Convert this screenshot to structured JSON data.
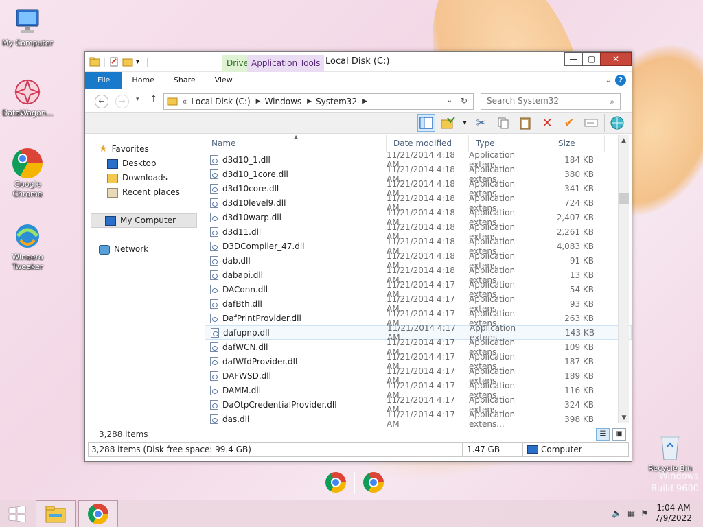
{
  "desktop": {
    "icons": [
      {
        "label": "My Computer"
      },
      {
        "label": "DataWagon..."
      },
      {
        "label": "Google Chrome"
      },
      {
        "label": "Winaero Tweaker"
      },
      {
        "label": "Recycle Bin"
      }
    ],
    "watermark_line1": "Windows",
    "watermark_line2": "Build 9600"
  },
  "window": {
    "title": "Local Disk (C:)",
    "context_tab_drive": "Drive",
    "context_tab_app": "Application Tools",
    "controls": {
      "minimize": "—",
      "maximize": "▢",
      "close": "✕"
    },
    "ribbon_tabs": [
      "File",
      "Home",
      "Share",
      "View"
    ],
    "address": {
      "prefix": "«",
      "segments": [
        "Local Disk (C:)",
        "Windows",
        "System32"
      ]
    },
    "search": {
      "placeholder": "Search System32"
    },
    "nav": {
      "favorites": "Favorites",
      "desktop": "Desktop",
      "downloads": "Downloads",
      "recent": "Recent places",
      "my_computer": "My Computer",
      "network": "Network"
    },
    "columns": {
      "name": "Name",
      "date": "Date modified",
      "type": "Type",
      "size": "Size"
    },
    "files": [
      {
        "name": "d3d10_1.dll",
        "date": "11/21/2014 4:18 AM",
        "type": "Application extens...",
        "size": "184 KB"
      },
      {
        "name": "d3d10_1core.dll",
        "date": "11/21/2014 4:18 AM",
        "type": "Application extens...",
        "size": "380 KB"
      },
      {
        "name": "d3d10core.dll",
        "date": "11/21/2014 4:18 AM",
        "type": "Application extens...",
        "size": "341 KB"
      },
      {
        "name": "d3d10level9.dll",
        "date": "11/21/2014 4:18 AM",
        "type": "Application extens...",
        "size": "724 KB"
      },
      {
        "name": "d3d10warp.dll",
        "date": "11/21/2014 4:18 AM",
        "type": "Application extens...",
        "size": "2,407 KB"
      },
      {
        "name": "d3d11.dll",
        "date": "11/21/2014 4:18 AM",
        "type": "Application extens...",
        "size": "2,261 KB"
      },
      {
        "name": "D3DCompiler_47.dll",
        "date": "11/21/2014 4:18 AM",
        "type": "Application extens...",
        "size": "4,083 KB"
      },
      {
        "name": "dab.dll",
        "date": "11/21/2014 4:18 AM",
        "type": "Application extens...",
        "size": "91 KB"
      },
      {
        "name": "dabapi.dll",
        "date": "11/21/2014 4:18 AM",
        "type": "Application extens...",
        "size": "13 KB"
      },
      {
        "name": "DAConn.dll",
        "date": "11/21/2014 4:17 AM",
        "type": "Application extens...",
        "size": "54 KB"
      },
      {
        "name": "dafBth.dll",
        "date": "11/21/2014 4:17 AM",
        "type": "Application extens...",
        "size": "93 KB"
      },
      {
        "name": "DafPrintProvider.dll",
        "date": "11/21/2014 4:17 AM",
        "type": "Application extens...",
        "size": "263 KB"
      },
      {
        "name": "dafupnp.dll",
        "date": "11/21/2014 4:17 AM",
        "type": "Application extens...",
        "size": "143 KB"
      },
      {
        "name": "dafWCN.dll",
        "date": "11/21/2014 4:17 AM",
        "type": "Application extens...",
        "size": "109 KB"
      },
      {
        "name": "dafWfdProvider.dll",
        "date": "11/21/2014 4:17 AM",
        "type": "Application extens...",
        "size": "187 KB"
      },
      {
        "name": "DAFWSD.dll",
        "date": "11/21/2014 4:17 AM",
        "type": "Application extens...",
        "size": "189 KB"
      },
      {
        "name": "DAMM.dll",
        "date": "11/21/2014 4:17 AM",
        "type": "Application extens...",
        "size": "116 KB"
      },
      {
        "name": "DaOtpCredentialProvider.dll",
        "date": "11/21/2014 4:17 AM",
        "type": "Application extens...",
        "size": "324 KB"
      },
      {
        "name": "das.dll",
        "date": "11/21/2014 4:17 AM",
        "type": "Application extens...",
        "size": "398 KB"
      }
    ],
    "item_count": "3,288 items",
    "status": {
      "left": "3,288 items (Disk free space: 99.4 GB)",
      "size": "1.47 GB",
      "location": "Computer"
    }
  },
  "taskbar": {
    "time": "1:04 AM",
    "date": "7/9/2022"
  },
  "colors": {
    "accent": "#1979ca",
    "close": "#c7473a"
  }
}
